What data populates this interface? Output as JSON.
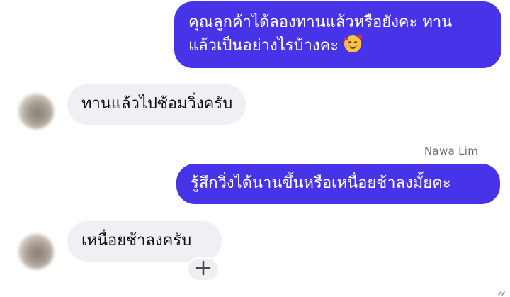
{
  "messages": [
    {
      "direction": "outgoing",
      "lines": [
        "คุณลูกค้าได้ลองทานแล้วหรือยังคะ ทาน",
        "แล้วเป็นอย่างไรบ้างคะ"
      ],
      "emoji": "smiling-face-with-hearts-icon"
    },
    {
      "direction": "incoming",
      "text": "ทานแล้วไปซ้อมวิ่งครับ"
    },
    {
      "direction": "outgoing",
      "sender": "Nawa Lim",
      "text": "รู้สึกวิ่งได้นานขึ้นหรือเหนื่อยช้าลงมั้ยคะ"
    },
    {
      "direction": "incoming",
      "text": "เหนื่อยช้าลงครับ"
    }
  ],
  "colors": {
    "outgoing_bubble": "#4733e8",
    "incoming_bubble": "#eef0f3"
  },
  "icons": {
    "add_reaction": "plus-icon"
  }
}
